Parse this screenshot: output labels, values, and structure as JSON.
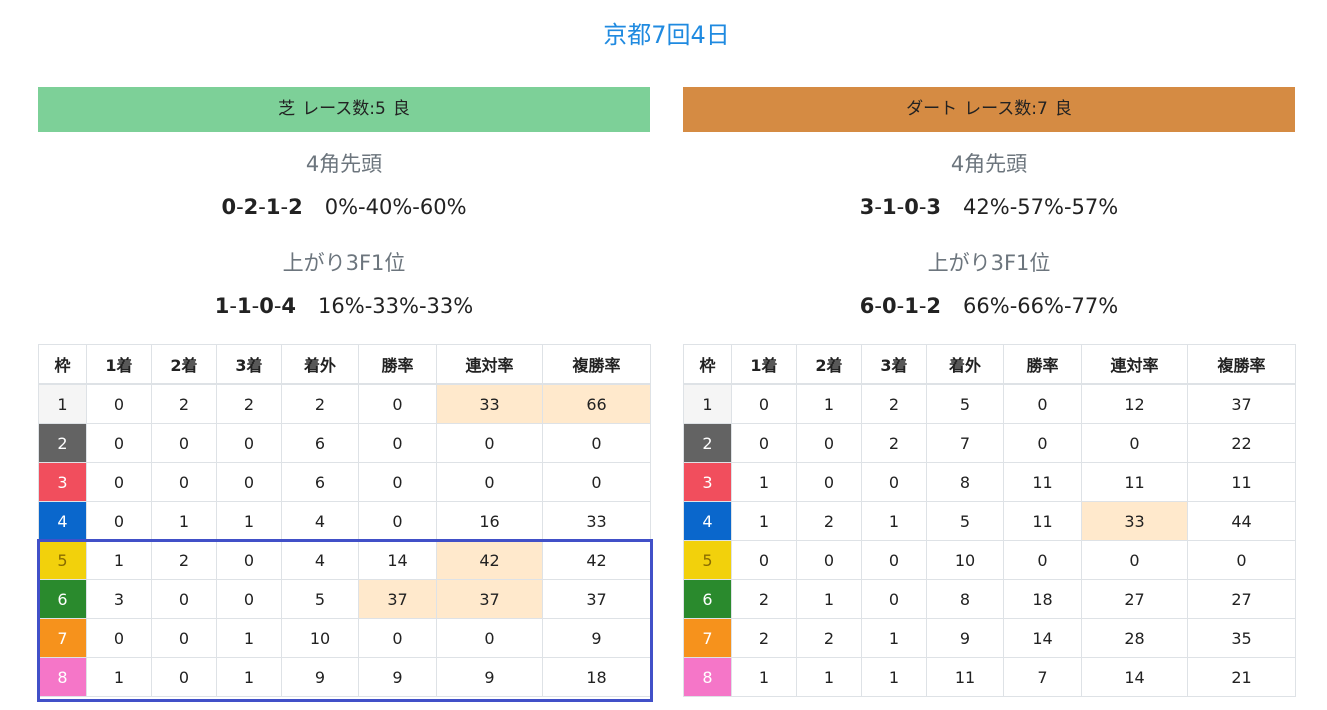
{
  "page_title": "京都7回4日",
  "colors": {
    "turf_header": "#7dd098",
    "dirt_header": "#d58b43",
    "title_blue": "#1f8ae0",
    "highlight": "#ffe9cc",
    "selection_border": "#4150c8",
    "waku": [
      "#f5f5f5",
      "#636363",
      "#f14e5d",
      "#0a67cc",
      "#f2d10c",
      "#2a8a2d",
      "#f6921c",
      "#f576c8"
    ]
  },
  "columns": [
    "枠",
    "1着",
    "2着",
    "3着",
    "着外",
    "勝率",
    "連対率",
    "複勝率"
  ],
  "turf": {
    "header_surface": "芝",
    "header_races": "レース数:5",
    "header_condition": "良",
    "front_heading": "4角先頭",
    "front_record": [
      "0",
      "2",
      "1",
      "2"
    ],
    "front_rates": "0%-40%-60%",
    "last3f_heading": "上がり3F1位",
    "last3f_record": [
      "1",
      "1",
      "0",
      "4"
    ],
    "last3f_rates": "16%-33%-33%",
    "rows": [
      [
        "1",
        "0",
        "2",
        "2",
        "2",
        "0",
        "33",
        "66"
      ],
      [
        "2",
        "0",
        "0",
        "0",
        "6",
        "0",
        "0",
        "0"
      ],
      [
        "3",
        "0",
        "0",
        "0",
        "6",
        "0",
        "0",
        "0"
      ],
      [
        "4",
        "0",
        "1",
        "1",
        "4",
        "0",
        "16",
        "33"
      ],
      [
        "5",
        "1",
        "2",
        "0",
        "4",
        "14",
        "42",
        "42"
      ],
      [
        "6",
        "3",
        "0",
        "0",
        "5",
        "37",
        "37",
        "37"
      ],
      [
        "7",
        "0",
        "0",
        "1",
        "10",
        "0",
        "0",
        "9"
      ],
      [
        "8",
        "1",
        "0",
        "1",
        "9",
        "9",
        "9",
        "18"
      ]
    ],
    "highlights": [
      [
        0,
        6
      ],
      [
        0,
        7
      ],
      [
        4,
        6
      ],
      [
        5,
        5
      ],
      [
        5,
        6
      ]
    ]
  },
  "dirt": {
    "header_surface": "ダート",
    "header_races": "レース数:7",
    "header_condition": "良",
    "front_heading": "4角先頭",
    "front_record": [
      "3",
      "1",
      "0",
      "3"
    ],
    "front_rates": "42%-57%-57%",
    "last3f_heading": "上がり3F1位",
    "last3f_record": [
      "6",
      "0",
      "1",
      "2"
    ],
    "last3f_rates": "66%-66%-77%",
    "rows": [
      [
        "1",
        "0",
        "1",
        "2",
        "5",
        "0",
        "12",
        "37"
      ],
      [
        "2",
        "0",
        "0",
        "2",
        "7",
        "0",
        "0",
        "22"
      ],
      [
        "3",
        "1",
        "0",
        "0",
        "8",
        "11",
        "11",
        "11"
      ],
      [
        "4",
        "1",
        "2",
        "1",
        "5",
        "11",
        "33",
        "44"
      ],
      [
        "5",
        "0",
        "0",
        "0",
        "10",
        "0",
        "0",
        "0"
      ],
      [
        "6",
        "2",
        "1",
        "0",
        "8",
        "18",
        "27",
        "27"
      ],
      [
        "7",
        "2",
        "2",
        "1",
        "9",
        "14",
        "28",
        "35"
      ],
      [
        "8",
        "1",
        "1",
        "1",
        "11",
        "7",
        "14",
        "21"
      ]
    ],
    "highlights": [
      [
        3,
        6
      ]
    ]
  }
}
